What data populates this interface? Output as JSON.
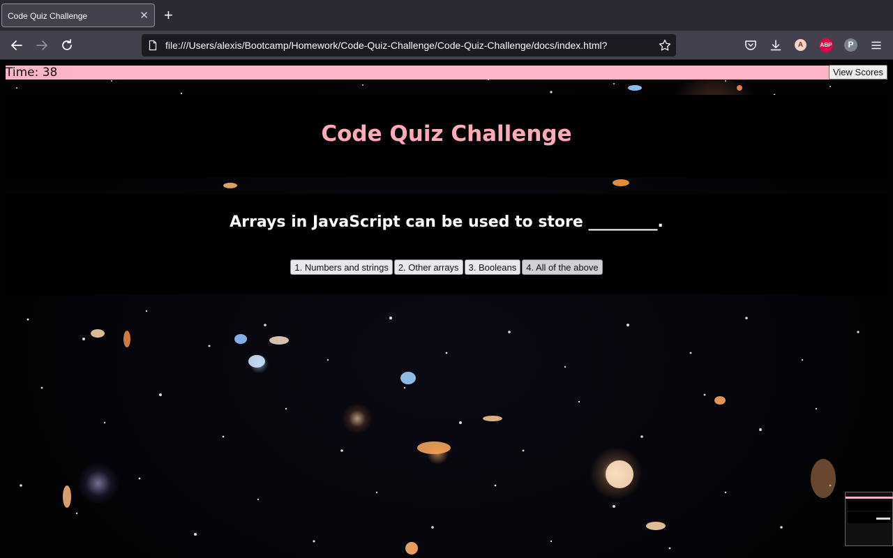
{
  "browser": {
    "tab_title": "Code Quiz Challenge",
    "url": "file:///Users/alexis/Bootcamp/Homework/Code-Quiz-Challenge/Code-Quiz-Challenge/docs/index.html?",
    "profile_initial": "A",
    "abp_label": "ABP",
    "extension_initial": "P"
  },
  "timer": {
    "label": "Time: 38"
  },
  "header": {
    "view_scores_label": "View Scores",
    "title": "Code Quiz Challenge"
  },
  "quiz": {
    "question": "Arrays in JavaScript can be used to store _________.",
    "answers": [
      "1. Numbers and strings",
      "2. Other arrays",
      "3. Booleans",
      "4. All of the above"
    ]
  },
  "colors": {
    "timer_bar": "#ffb3c6",
    "title_pink": "#ffaab6",
    "panel_bg": "#000000"
  }
}
